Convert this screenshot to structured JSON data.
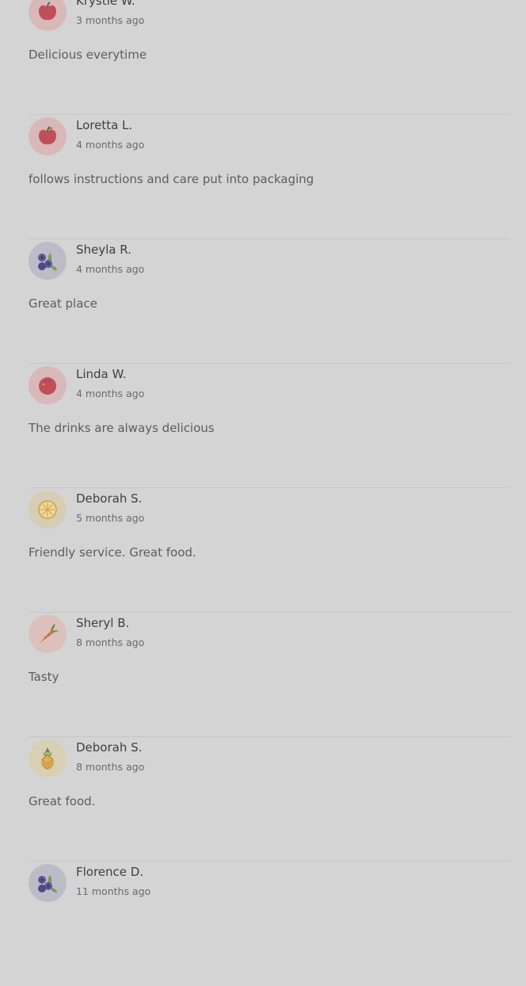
{
  "reviews": [
    {
      "name": "Krystle W.",
      "time": "3 months ago",
      "text": "Delicious everytime",
      "avatar_icon": "apple-icon",
      "avatar_bg": "#d8b8b9"
    },
    {
      "name": "Loretta L.",
      "time": "4 months ago",
      "text": "follows instructions and care put into packaging",
      "avatar_icon": "apple-icon",
      "avatar_bg": "#d8b8b9"
    },
    {
      "name": "Sheyla R.",
      "time": "4 months ago",
      "text": "Great place",
      "avatar_icon": "blueberries-icon",
      "avatar_bg": "#bcbcc9"
    },
    {
      "name": "Linda W.",
      "time": "4 months ago",
      "text": "The drinks are always delicious",
      "avatar_icon": "tomato-icon",
      "avatar_bg": "#d8b8b9"
    },
    {
      "name": "Deborah S.",
      "time": "5 months ago",
      "text": "Friendly service. Great food.",
      "avatar_icon": "lemon-slice-icon",
      "avatar_bg": "#d7cdb4"
    },
    {
      "name": "Sheryl B.",
      "time": "8 months ago",
      "text": "Tasty",
      "avatar_icon": "carrot-icon",
      "avatar_bg": "#dcc0bb"
    },
    {
      "name": "Deborah S.",
      "time": "8 months ago",
      "text": "Great food.",
      "avatar_icon": "pineapple-icon",
      "avatar_bg": "#d8d0b3"
    },
    {
      "name": "Florence D.",
      "time": "11 months ago",
      "text": "",
      "avatar_icon": "blueberries-icon",
      "avatar_bg": "#bcbcc9"
    }
  ]
}
